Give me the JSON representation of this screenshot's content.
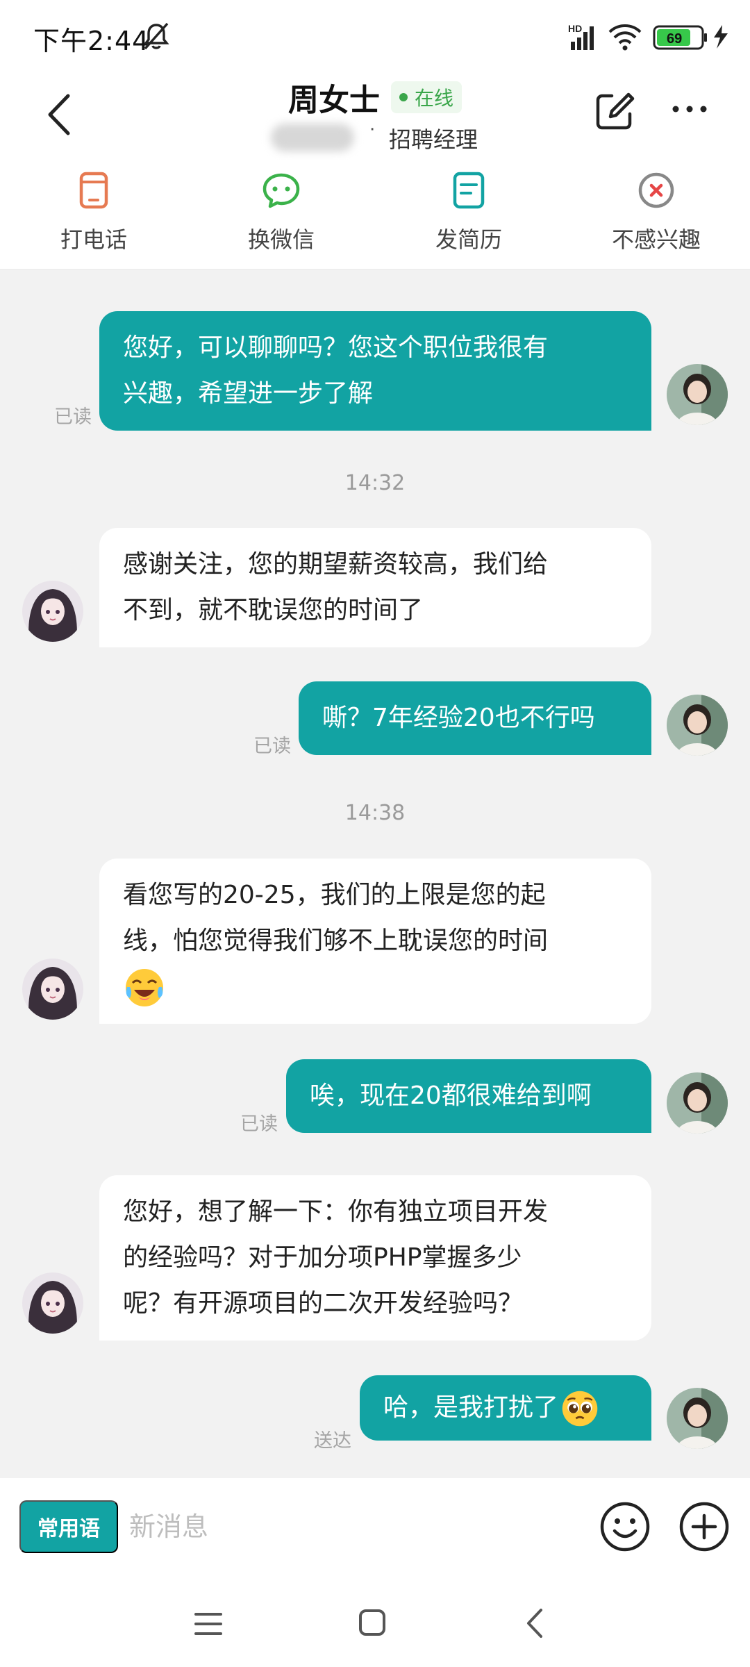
{
  "status_bar": {
    "time": "下午2:44",
    "battery": "69",
    "signal_label": "HD"
  },
  "header": {
    "name": "周女士",
    "status": "在线",
    "role": "招聘经理",
    "separator": "·"
  },
  "actions": [
    {
      "label": "打电话",
      "icon": "phone-icon"
    },
    {
      "label": "换微信",
      "icon": "wechat-icon"
    },
    {
      "label": "发简历",
      "icon": "resume-icon"
    },
    {
      "label": "不感兴趣",
      "icon": "not-interested-icon"
    }
  ],
  "messages": {
    "m1": {
      "lines": [
        "您好，可以聊聊吗？您这个职位我很有",
        "兴趣，希望进一步了解"
      ],
      "status": "已读"
    },
    "t1": "14:32",
    "m2": {
      "lines": [
        "感谢关注，您的期望薪资较高，我们给",
        "不到，就不耽误您的时间了"
      ]
    },
    "m3": {
      "text": "嘶？7年经验20也不行吗",
      "status": "已读"
    },
    "t2": "14:38",
    "m4": {
      "lines": [
        "看您写的20-25，我们的上限是您的起",
        "线，怕您觉得我们够不上耽误您的时间"
      ],
      "emoji": "laughing-crying-emoji"
    },
    "m5": {
      "text": "唉，现在20都很难给到啊",
      "status": "已读"
    },
    "m6": {
      "lines": [
        "您好，想了解一下：你有独立项目开发",
        "的经验吗？对于加分项PHP掌握多少",
        "呢？有开源项目的二次开发经验吗？"
      ]
    },
    "m7": {
      "text": "哈，是我打扰了",
      "emoji": "pleading-face-emoji",
      "status": "送达"
    }
  },
  "input_bar": {
    "phrases_label": "常用语",
    "placeholder": "新消息"
  },
  "colors": {
    "accent": "#12a3a3",
    "online": "#3aa64a",
    "background": "#f2f2f2"
  }
}
